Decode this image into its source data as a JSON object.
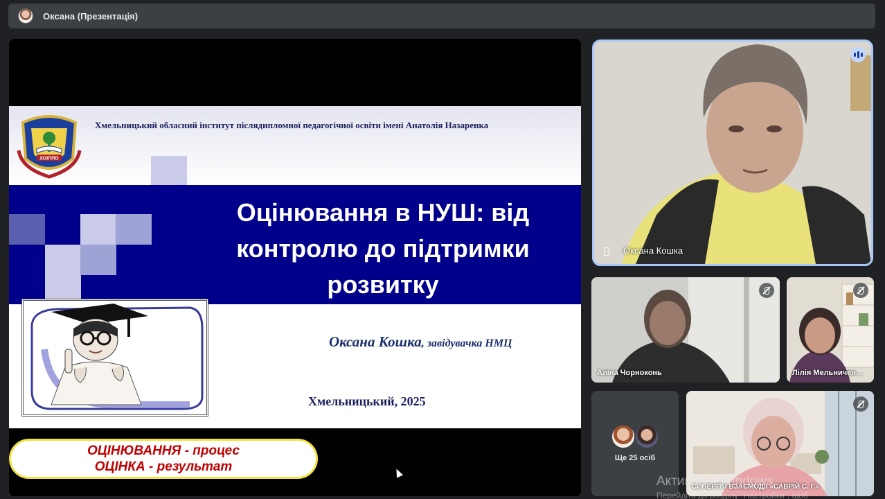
{
  "presenter_bar": {
    "title": "Оксана (Презентація)"
  },
  "slide": {
    "institute": "Хмельницький обласний інститут післядипломної педагогічної освіти імені Анатолія Назаренка",
    "emblem_text": "ХОІППО",
    "title_lines": [
      "Оцінювання в НУШ: від",
      "контролю до підтримки",
      "розвитку"
    ],
    "author_name": "Оксана Кошка",
    "author_role": ", завідувачка НМЦ",
    "city_year": "Хмельницький, 2025"
  },
  "caption": {
    "line1": "ОЦІНЮВАННЯ - процес",
    "line2": "ОЦІНКА - результат"
  },
  "participants": {
    "main": {
      "name": "Оксана Кошка",
      "status_icon": "speaking-icon"
    },
    "p2": {
      "name": "Аліна Чорноконь",
      "status_icon": "mic-off-icon"
    },
    "p3": {
      "name": "Лілія Мельничен…",
      "status_icon": "mic-off-icon"
    },
    "more": {
      "label": "Ще 25 осіб"
    },
    "p5": {
      "name": "СИНЕРГІЯ ВЗАЄМОДІЇ «САВРІЙ С. Г.»",
      "status_icon": "mic-off-icon"
    }
  },
  "watermark": {
    "line1": "Активація Windows",
    "line2": "Перейдіть до розділу \"Настройки\", щоб"
  },
  "colors": {
    "background": "#202124",
    "tile": "#3c4043",
    "active_speaker_border": "#a8c7fa",
    "slide_band": "#00008b",
    "caption_border": "#f5e342",
    "caption_text": "#c00000"
  }
}
